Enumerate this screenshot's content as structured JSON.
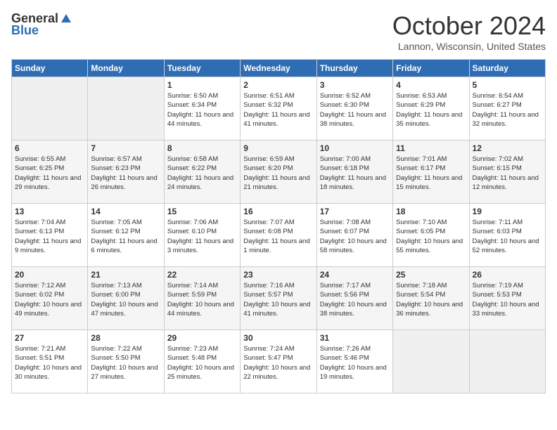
{
  "header": {
    "logo_general": "General",
    "logo_blue": "Blue",
    "month": "October 2024",
    "location": "Lannon, Wisconsin, United States"
  },
  "days_of_week": [
    "Sunday",
    "Monday",
    "Tuesday",
    "Wednesday",
    "Thursday",
    "Friday",
    "Saturday"
  ],
  "weeks": [
    [
      {
        "day": "",
        "info": ""
      },
      {
        "day": "",
        "info": ""
      },
      {
        "day": "1",
        "info": "Sunrise: 6:50 AM\nSunset: 6:34 PM\nDaylight: 11 hours and 44 minutes."
      },
      {
        "day": "2",
        "info": "Sunrise: 6:51 AM\nSunset: 6:32 PM\nDaylight: 11 hours and 41 minutes."
      },
      {
        "day": "3",
        "info": "Sunrise: 6:52 AM\nSunset: 6:30 PM\nDaylight: 11 hours and 38 minutes."
      },
      {
        "day": "4",
        "info": "Sunrise: 6:53 AM\nSunset: 6:29 PM\nDaylight: 11 hours and 35 minutes."
      },
      {
        "day": "5",
        "info": "Sunrise: 6:54 AM\nSunset: 6:27 PM\nDaylight: 11 hours and 32 minutes."
      }
    ],
    [
      {
        "day": "6",
        "info": "Sunrise: 6:55 AM\nSunset: 6:25 PM\nDaylight: 11 hours and 29 minutes."
      },
      {
        "day": "7",
        "info": "Sunrise: 6:57 AM\nSunset: 6:23 PM\nDaylight: 11 hours and 26 minutes."
      },
      {
        "day": "8",
        "info": "Sunrise: 6:58 AM\nSunset: 6:22 PM\nDaylight: 11 hours and 24 minutes."
      },
      {
        "day": "9",
        "info": "Sunrise: 6:59 AM\nSunset: 6:20 PM\nDaylight: 11 hours and 21 minutes."
      },
      {
        "day": "10",
        "info": "Sunrise: 7:00 AM\nSunset: 6:18 PM\nDaylight: 11 hours and 18 minutes."
      },
      {
        "day": "11",
        "info": "Sunrise: 7:01 AM\nSunset: 6:17 PM\nDaylight: 11 hours and 15 minutes."
      },
      {
        "day": "12",
        "info": "Sunrise: 7:02 AM\nSunset: 6:15 PM\nDaylight: 11 hours and 12 minutes."
      }
    ],
    [
      {
        "day": "13",
        "info": "Sunrise: 7:04 AM\nSunset: 6:13 PM\nDaylight: 11 hours and 9 minutes."
      },
      {
        "day": "14",
        "info": "Sunrise: 7:05 AM\nSunset: 6:12 PM\nDaylight: 11 hours and 6 minutes."
      },
      {
        "day": "15",
        "info": "Sunrise: 7:06 AM\nSunset: 6:10 PM\nDaylight: 11 hours and 3 minutes."
      },
      {
        "day": "16",
        "info": "Sunrise: 7:07 AM\nSunset: 6:08 PM\nDaylight: 11 hours and 1 minute."
      },
      {
        "day": "17",
        "info": "Sunrise: 7:08 AM\nSunset: 6:07 PM\nDaylight: 10 hours and 58 minutes."
      },
      {
        "day": "18",
        "info": "Sunrise: 7:10 AM\nSunset: 6:05 PM\nDaylight: 10 hours and 55 minutes."
      },
      {
        "day": "19",
        "info": "Sunrise: 7:11 AM\nSunset: 6:03 PM\nDaylight: 10 hours and 52 minutes."
      }
    ],
    [
      {
        "day": "20",
        "info": "Sunrise: 7:12 AM\nSunset: 6:02 PM\nDaylight: 10 hours and 49 minutes."
      },
      {
        "day": "21",
        "info": "Sunrise: 7:13 AM\nSunset: 6:00 PM\nDaylight: 10 hours and 47 minutes."
      },
      {
        "day": "22",
        "info": "Sunrise: 7:14 AM\nSunset: 5:59 PM\nDaylight: 10 hours and 44 minutes."
      },
      {
        "day": "23",
        "info": "Sunrise: 7:16 AM\nSunset: 5:57 PM\nDaylight: 10 hours and 41 minutes."
      },
      {
        "day": "24",
        "info": "Sunrise: 7:17 AM\nSunset: 5:56 PM\nDaylight: 10 hours and 38 minutes."
      },
      {
        "day": "25",
        "info": "Sunrise: 7:18 AM\nSunset: 5:54 PM\nDaylight: 10 hours and 36 minutes."
      },
      {
        "day": "26",
        "info": "Sunrise: 7:19 AM\nSunset: 5:53 PM\nDaylight: 10 hours and 33 minutes."
      }
    ],
    [
      {
        "day": "27",
        "info": "Sunrise: 7:21 AM\nSunset: 5:51 PM\nDaylight: 10 hours and 30 minutes."
      },
      {
        "day": "28",
        "info": "Sunrise: 7:22 AM\nSunset: 5:50 PM\nDaylight: 10 hours and 27 minutes."
      },
      {
        "day": "29",
        "info": "Sunrise: 7:23 AM\nSunset: 5:48 PM\nDaylight: 10 hours and 25 minutes."
      },
      {
        "day": "30",
        "info": "Sunrise: 7:24 AM\nSunset: 5:47 PM\nDaylight: 10 hours and 22 minutes."
      },
      {
        "day": "31",
        "info": "Sunrise: 7:26 AM\nSunset: 5:46 PM\nDaylight: 10 hours and 19 minutes."
      },
      {
        "day": "",
        "info": ""
      },
      {
        "day": "",
        "info": ""
      }
    ]
  ]
}
